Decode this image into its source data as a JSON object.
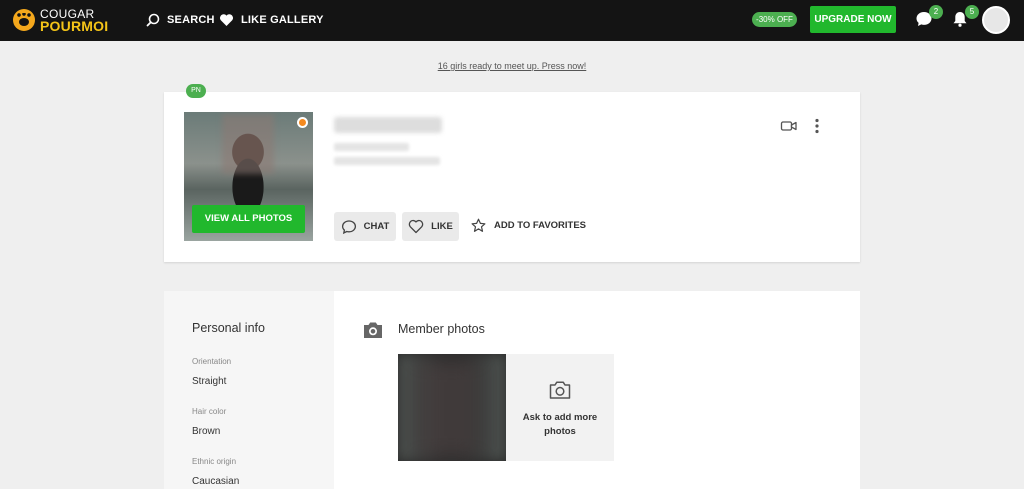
{
  "header": {
    "logo_top": "COUGAR",
    "logo_bottom": "POURMOI",
    "nav": [
      {
        "label": "SEARCH",
        "icon": "search-icon"
      },
      {
        "label": "LIKE GALLERY",
        "icon": "heart-icon"
      }
    ],
    "discount": "-30% OFF",
    "upgrade_label": "UPGRADE NOW",
    "messages_count": "2",
    "notifications_count": "5"
  },
  "promo_link": "16 girls ready to meet up. Press now!",
  "profile": {
    "badge": "PN",
    "view_all_photos": "VIEW ALL PHOTOS",
    "actions": {
      "chat": "CHAT",
      "like": "LIKE",
      "favorites": "ADD TO FAVORITES"
    },
    "icons": [
      "video-camera-icon",
      "more-vert-icon",
      "chat-bubble-icon",
      "heart-outline-icon",
      "star-outline-icon"
    ]
  },
  "personal_info": {
    "title": "Personal info",
    "fields": [
      {
        "label": "Orientation",
        "value": "Straight"
      },
      {
        "label": "Hair color",
        "value": "Brown"
      },
      {
        "label": "Ethnic origin",
        "value": "Caucasian"
      }
    ]
  },
  "member_photos": {
    "title": "Member photos",
    "ask_more": "Ask to add more photos"
  },
  "colors": {
    "topbar": "#141414",
    "accent_green": "#21b82d",
    "badge_green": "#4caf50",
    "online_orange": "#f58a1f",
    "logo_yellow": "#f5c518"
  }
}
